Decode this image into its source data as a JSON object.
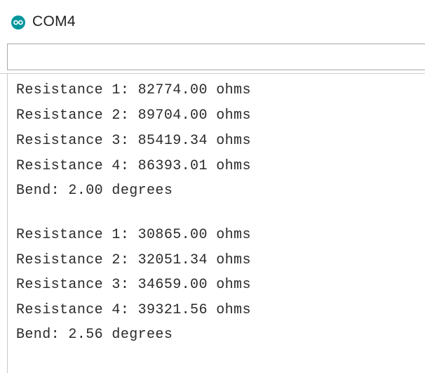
{
  "window": {
    "title": "COM4"
  },
  "send": {
    "value": ""
  },
  "output": {
    "lines": [
      "Resistance 1: 82774.00 ohms",
      "Resistance 2: 89704.00 ohms",
      "Resistance 3: 85419.34 ohms",
      "Resistance 4: 86393.01 ohms",
      "Bend: 2.00 degrees",
      "",
      "Resistance 1: 30865.00 ohms",
      "Resistance 2: 32051.34 ohms",
      "Resistance 3: 34659.00 ohms",
      "Resistance 4: 39321.56 ohms",
      "Bend: 2.56 degrees"
    ]
  },
  "colors": {
    "icon": "#00979c",
    "text": "#2b2b2b"
  },
  "icons": {
    "app": "arduino-icon"
  }
}
